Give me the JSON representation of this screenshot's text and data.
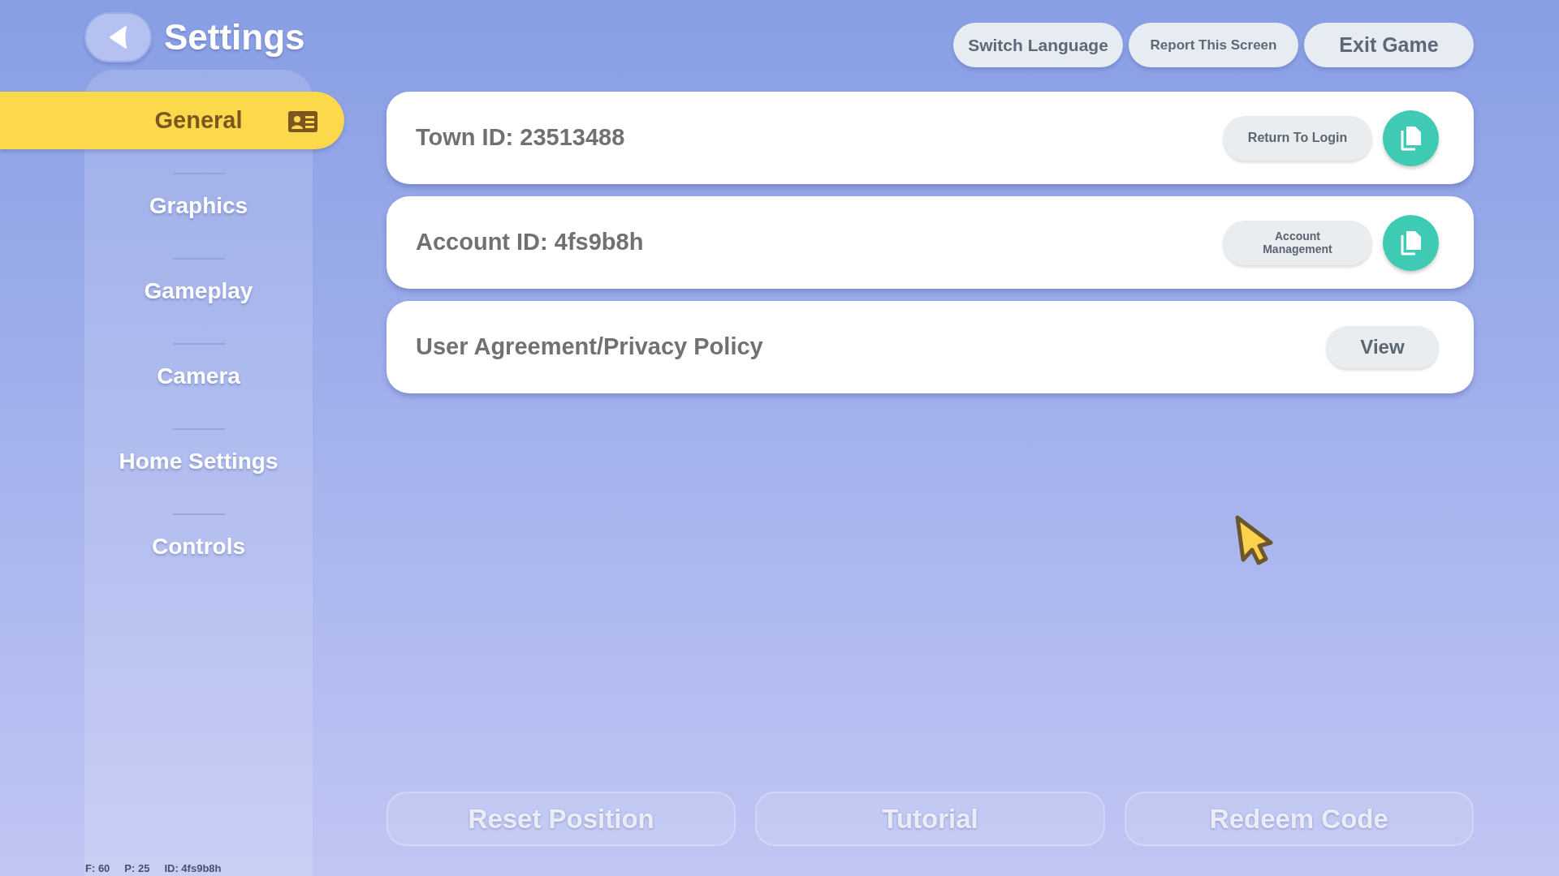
{
  "header": {
    "title": "Settings"
  },
  "top_buttons": [
    {
      "label": "Switch Language",
      "kind": "medium"
    },
    {
      "label": "Report This Screen",
      "kind": "small"
    },
    {
      "label": "Exit Game",
      "kind": "large"
    }
  ],
  "sidebar": {
    "items": [
      {
        "label": "General",
        "selected": true
      },
      {
        "label": "Graphics",
        "selected": false
      },
      {
        "label": "Gameplay",
        "selected": false
      },
      {
        "label": "Camera",
        "selected": false
      },
      {
        "label": "Home Settings",
        "selected": false
      },
      {
        "label": "Controls",
        "selected": false
      }
    ]
  },
  "rows": [
    {
      "label": "Town ID: 23513488",
      "action": {
        "label": "Return To Login",
        "kind": "small"
      },
      "copy_button": true
    },
    {
      "label": "Account ID: 4fs9b8h",
      "action": {
        "label": "Account Management",
        "kind": "tiny"
      },
      "copy_button": true
    },
    {
      "label": "User Agreement/Privacy Policy",
      "action": {
        "label": "View",
        "kind": "large"
      },
      "copy_button": false
    }
  ],
  "bottom_buttons": [
    {
      "label": "Reset Position",
      "disabled": true
    },
    {
      "label": "Tutorial",
      "disabled": true
    },
    {
      "label": "Redeem Code",
      "disabled": true
    }
  ],
  "status_bar": {
    "items": [
      "F: 60",
      "P: 25",
      "ID: 4fs9b8h"
    ]
  }
}
